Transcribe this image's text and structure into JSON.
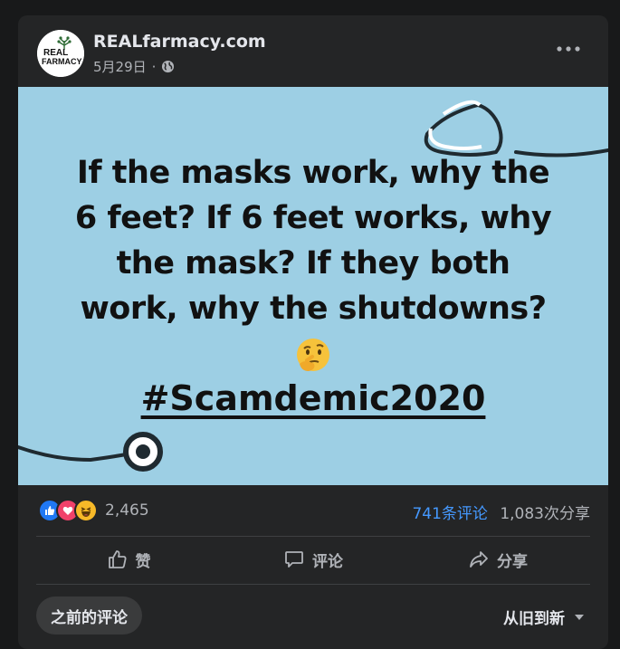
{
  "post": {
    "page_name": "REALfarmacy.com",
    "date": "5月29日",
    "separator": "·",
    "avatar_text_top": "REAL",
    "avatar_text_bottom": "FARMACY"
  },
  "image": {
    "lines": [
      "If the masks work, why the",
      "6 feet? If 6 feet works, why",
      "the mask? If they both",
      "work, why the shutdowns?"
    ],
    "hashtag": "#Scamdemic2020",
    "background": "#9dcfe4"
  },
  "stats": {
    "reaction_count": "2,465",
    "comments": "741条评论",
    "shares": "1,083次分享",
    "reaction_icons": [
      "like-icon",
      "love-icon",
      "haha-icon"
    ]
  },
  "actions": {
    "like": "赞",
    "comment": "评论",
    "share": "分享"
  },
  "comments_bar": {
    "earlier_comments": "之前的评论",
    "sort_label": "从旧到新"
  },
  "colors": {
    "background": "#18191a",
    "card": "#242526",
    "link_blue": "#4599ff",
    "muted_text": "#b0b3b8"
  }
}
